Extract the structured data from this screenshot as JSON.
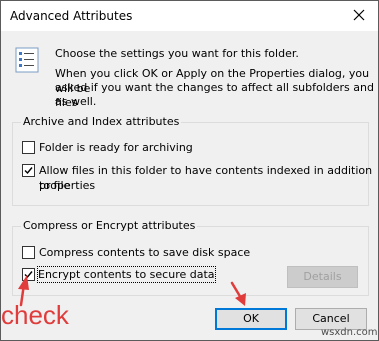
{
  "window": {
    "title": "Advanced Attributes",
    "close_icon": "close-x-icon"
  },
  "header": {
    "icon": "file-settings-icon",
    "line1": "Choose the settings you want for this folder.",
    "line2": "When you click OK or Apply on the Properties dialog, you will be",
    "line3": "asked if you want the changes to affect all subfolders and files",
    "line4": "as well."
  },
  "archive_group": {
    "label": "Archive and Index attributes",
    "items": [
      {
        "label": "Folder is ready for archiving",
        "checked": false
      },
      {
        "label_line1": "Allow files in this folder to have contents indexed in addition to file",
        "label_line2": "properties",
        "checked": true
      }
    ]
  },
  "compress_group": {
    "label": "Compress or Encrypt attributes",
    "items": [
      {
        "label": "Compress contents to save disk space",
        "checked": false
      },
      {
        "label": "Encrypt contents to secure data",
        "checked": true
      }
    ],
    "details_label": "Details"
  },
  "buttons": {
    "ok_label": "OK",
    "cancel_label": "Cancel"
  },
  "annotations": {
    "check_text": "check",
    "color": "#e03c3c"
  },
  "watermark": "wsxdn.com"
}
